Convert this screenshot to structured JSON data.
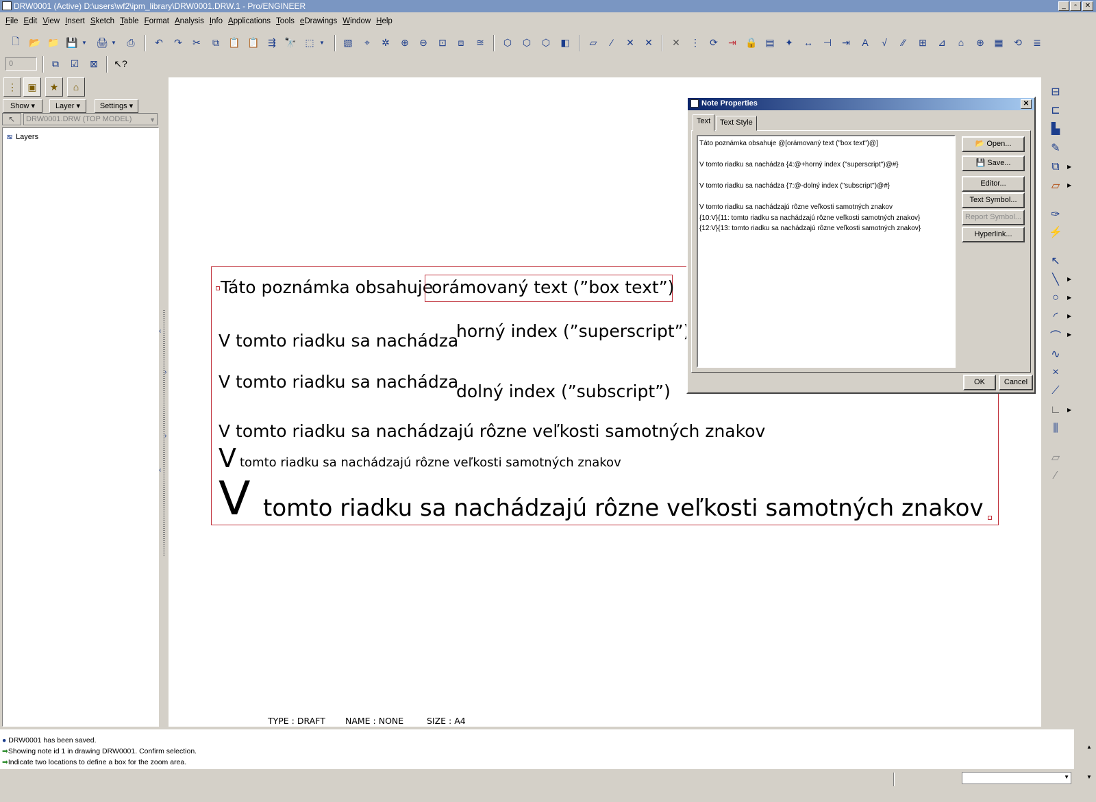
{
  "window": {
    "title": "DRW0001 (Active) D:\\users\\wf2\\ipm_library\\DRW0001.DRW.1 - Pro/ENGINEER",
    "minimize_glyph": "_",
    "maximize_glyph": "▫",
    "close_glyph": "✕"
  },
  "menu": [
    "File",
    "Edit",
    "View",
    "Insert",
    "Sketch",
    "Table",
    "Format",
    "Analysis",
    "Info",
    "Applications",
    "Tools",
    "eDrawings",
    "Window",
    "Help"
  ],
  "toolbar2": {
    "spinner_value": "0"
  },
  "left_panel": {
    "show_label": "Show",
    "layer_label": "Layer",
    "settings_label": "Settings",
    "model_select": "DRW0001.DRW (TOP MODEL)",
    "tree_root": "Layers"
  },
  "drawing_note": {
    "line1_prefix": "Táto poznámka obsahuje",
    "line1_boxed": "orámovaný text (”box text”)",
    "line2_main": "V tomto riadku sa nachádza",
    "line2_super": "horný index (”superscript”)",
    "line3_main": "V tomto riadku sa nachádza",
    "line3_sub": "dolný index (”subscript”)",
    "line4": "V tomto riadku sa nachádzajú rôzne veľkosti samotných znakov",
    "line5_big": "V",
    "line5_rest": "tomto riadku sa nachádzajú rôzne veľkosti samotných znakov",
    "line6_big": "V",
    "line6_rest": "tomto riadku sa nachádzajú rôzne veľkosti samotných znakov"
  },
  "sheet_info": {
    "type": "TYPE : DRAFT",
    "name": "NAME : NONE",
    "size": "SIZE : A4"
  },
  "dialog": {
    "title": "Note Properties",
    "tabs": [
      "Text",
      "Text Style"
    ],
    "text_lines": [
      "Táto poznámka obsahuje @[orámovaný text (\"box text\")@]",
      "",
      "V tomto riadku sa nachádza {4:@+horný index (\"superscript\")@#}",
      "",
      "V tomto riadku sa nachádza {7:@-dolný index (\"subscript\")@#}",
      "",
      "V tomto riadku sa nachádzajú rôzne veľkosti samotných znakov",
      "{10:V}{11: tomto riadku sa nachádzajú rôzne veľkosti samotných znakov}",
      "{12:V}{13: tomto riadku sa nachádzajú rôzne veľkosti samotných znakov}"
    ],
    "buttons": {
      "open": "Open...",
      "save": "Save...",
      "editor": "Editor...",
      "text_symbol": "Text Symbol...",
      "report_symbol": "Report Symbol...",
      "hyperlink": "Hyperlink...",
      "ok": "OK",
      "cancel": "Cancel"
    },
    "close_glyph": "✕"
  },
  "messages": [
    "DRW0001 has been saved.",
    "Showing note id 1 in drawing DRW0001. Confirm selection.",
    "Indicate two locations to define a box for the zoom area."
  ],
  "colors": {
    "note_frame": "#c0303a",
    "titlebar": "#7a96c2",
    "dialog_title": "#0a246a",
    "icon_blue": "#1c3d8c"
  }
}
